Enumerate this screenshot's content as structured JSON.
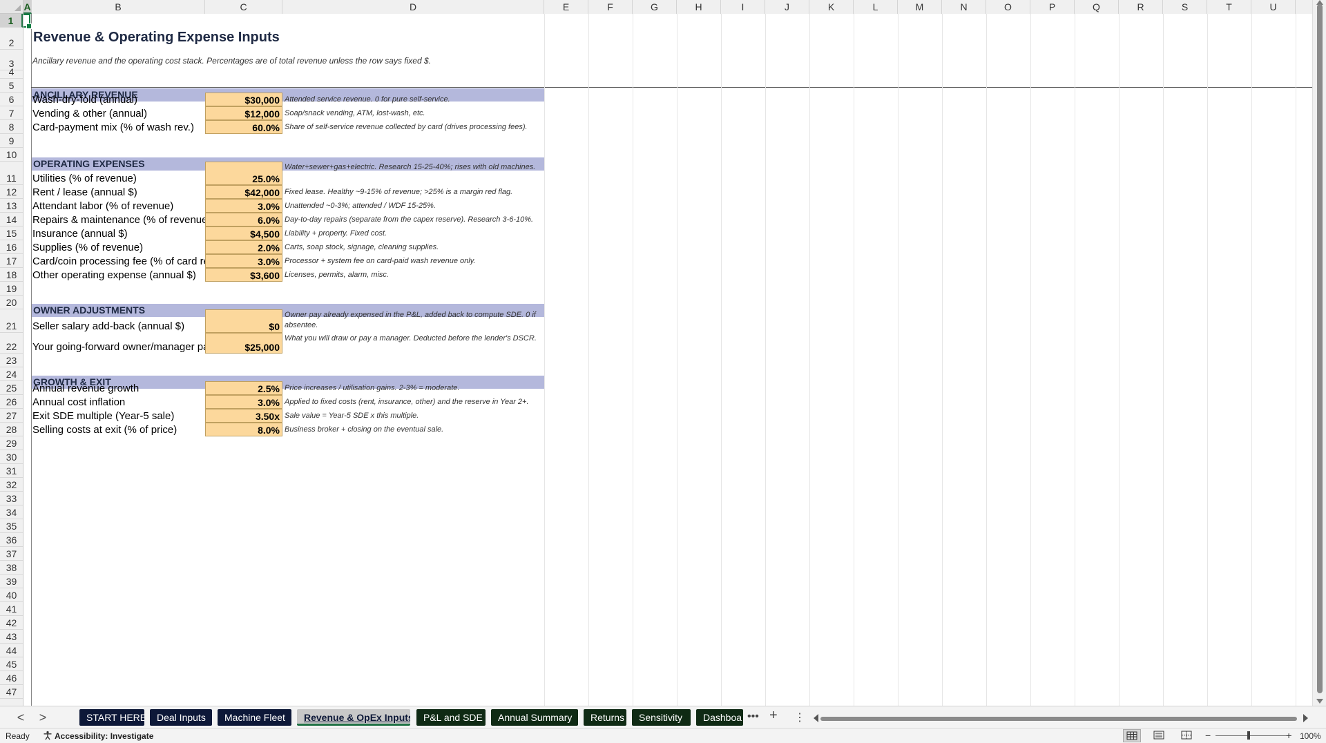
{
  "columns": [
    "A",
    "B",
    "C",
    "D",
    "E",
    "F",
    "G",
    "H",
    "I",
    "J",
    "K",
    "L",
    "M",
    "N",
    "O",
    "P",
    "Q",
    "R",
    "S",
    "T",
    "U"
  ],
  "rows": [
    "1",
    "2",
    "3",
    "4",
    "5",
    "6",
    "7",
    "8",
    "9",
    "10",
    "11",
    "12",
    "13",
    "14",
    "15",
    "16",
    "17",
    "18",
    "19",
    "20",
    "21",
    "22",
    "23",
    "24",
    "25",
    "26",
    "27",
    "28",
    "29",
    "30",
    "31",
    "32",
    "33",
    "34",
    "35",
    "36",
    "37",
    "38",
    "39",
    "40",
    "41",
    "42",
    "43",
    "44",
    "45",
    "46",
    "47"
  ],
  "sheet": {
    "title": "Revenue & Operating Expense Inputs",
    "subtitle": "Ancillary revenue and the operating cost stack. Percentages are of total revenue unless the row says fixed $.",
    "sections": {
      "ancillary": "ANCILLARY REVENUE",
      "opex": "OPERATING EXPENSES",
      "owner": "OWNER ADJUSTMENTS",
      "growth": "GROWTH & EXIT"
    },
    "items": [
      {
        "label": "Wash-dry-fold (annual)",
        "value": "$30,000",
        "note": "Attended service revenue. 0 for pure self-service."
      },
      {
        "label": "Vending & other (annual)",
        "value": "$12,000",
        "note": "Soap/snack vending, ATM, lost-wash, etc."
      },
      {
        "label": "Card-payment mix (% of wash rev.)",
        "value": "60.0%",
        "note": "Share of self-service revenue collected by card (drives processing fees)."
      },
      {
        "label": "Utilities (% of revenue)",
        "value": "25.0%",
        "note": "Water+sewer+gas+electric. Research 15-25-40%; rises with old machines."
      },
      {
        "label": "Rent / lease (annual $)",
        "value": "$42,000",
        "note": "Fixed lease. Healthy ~9-15% of revenue; >25% is a margin red flag."
      },
      {
        "label": "Attendant labor (% of revenue)",
        "value": "3.0%",
        "note": "Unattended ~0-3%; attended / WDF 15-25%."
      },
      {
        "label": "Repairs & maintenance (% of revenue)",
        "value": "6.0%",
        "note": "Day-to-day repairs (separate from the capex reserve). Research 3-6-10%."
      },
      {
        "label": "Insurance (annual $)",
        "value": "$4,500",
        "note": "Liability + property. Fixed cost."
      },
      {
        "label": "Supplies (% of revenue)",
        "value": "2.0%",
        "note": "Carts, soap stock, signage, cleaning supplies."
      },
      {
        "label": "Card/coin processing fee (% of card rev.)",
        "value": "3.0%",
        "note": "Processor + system fee on card-paid wash revenue only."
      },
      {
        "label": "Other operating expense (annual $)",
        "value": "$3,600",
        "note": "Licenses, permits, alarm, misc."
      },
      {
        "label": "Seller salary add-back (annual $)",
        "value": "$0",
        "note": "Owner pay already expensed in the P&L, added back to compute SDE. 0 if absentee."
      },
      {
        "label": "Your going-forward owner/manager pay",
        "value": "$25,000",
        "note": "What you will draw or pay a manager. Deducted before the lender's DSCR."
      },
      {
        "label": "Annual revenue growth",
        "value": "2.5%",
        "note": "Price increases / utilisation gains. 2-3% = moderate."
      },
      {
        "label": "Annual cost inflation",
        "value": "3.0%",
        "note": "Applied to fixed costs (rent, insurance, other) and the reserve in Year 2+."
      },
      {
        "label": "Exit SDE multiple (Year-5 sale)",
        "value": "3.50x",
        "note": "Sale value = Year-5 SDE x this multiple."
      },
      {
        "label": "Selling costs at exit (% of price)",
        "value": "8.0%",
        "note": "Business broker + closing on the eventual sale."
      }
    ]
  },
  "tabs": {
    "prev": "<",
    "next": ">",
    "list": [
      "START HERE",
      "Deal Inputs",
      "Machine Fleet",
      "Revenue & OpEx Inputs",
      "P&L and SDE",
      "Annual Summary",
      "Returns",
      "Sensitivity",
      "Dashboa"
    ],
    "more": "•••",
    "add": "+",
    "menu": "⋮"
  },
  "status": {
    "ready": "Ready",
    "accessibility": "Accessibility: Investigate",
    "zoom": "100%",
    "zoom_minus": "−",
    "zoom_plus": "+"
  },
  "colors": {
    "section_band": "#b4b8dc",
    "input_fill": "#fcd89c",
    "tab_dark": "#0d1838",
    "tab_green": "#0f2a14",
    "excel_green": "#217346"
  }
}
